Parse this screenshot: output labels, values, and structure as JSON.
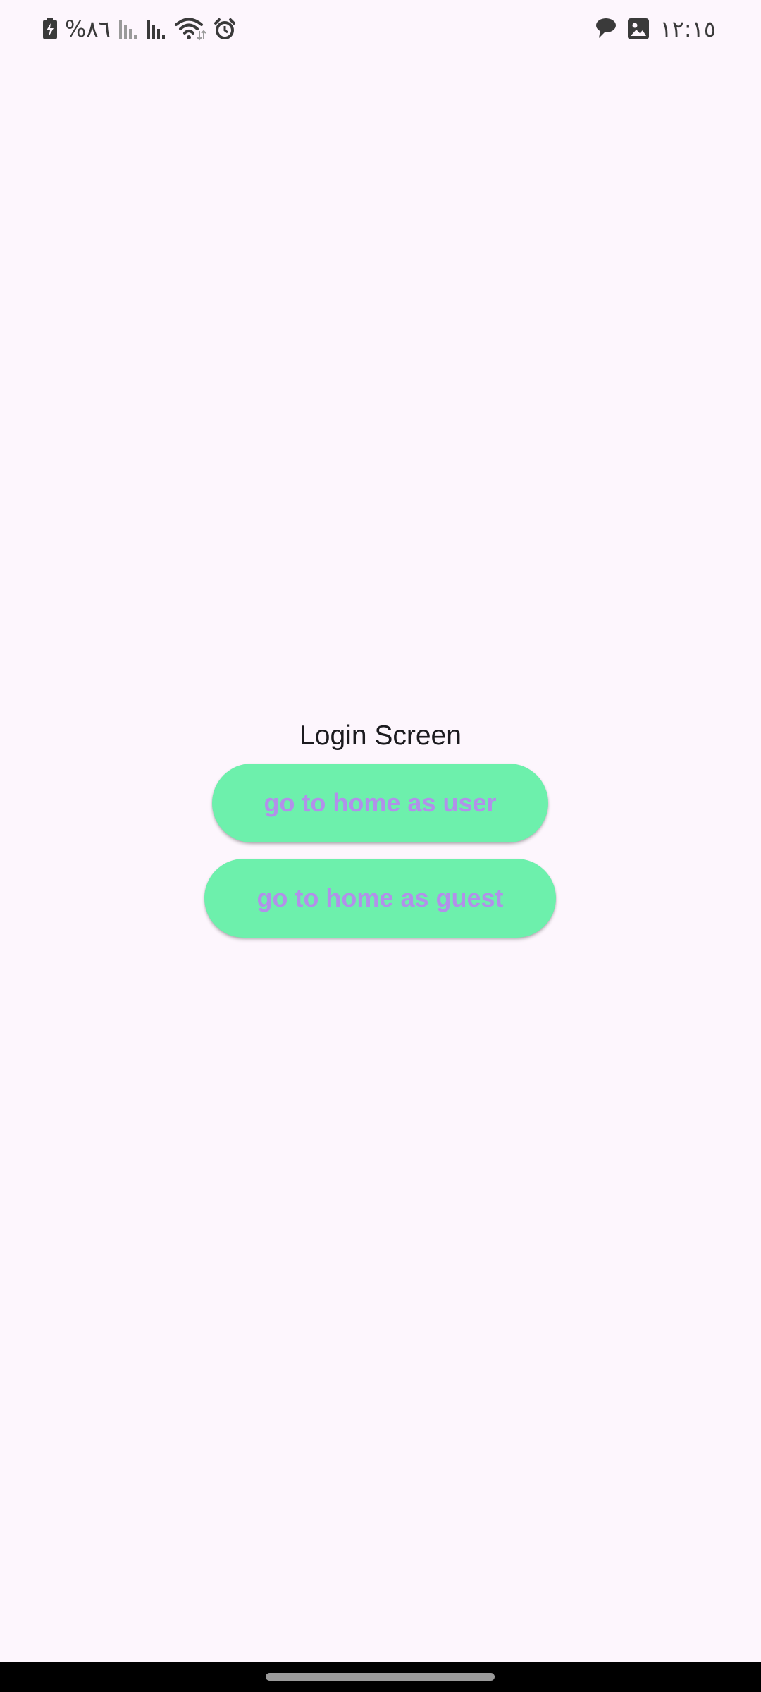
{
  "status_bar": {
    "battery_percent": "%٨٦",
    "time": "١٢:١٥",
    "icons_left": [
      "battery-charging-icon",
      "signal-icon",
      "signal-icon",
      "wifi-icon",
      "alarm-icon"
    ],
    "icons_right": [
      "chat-icon",
      "image-icon"
    ]
  },
  "main": {
    "title": "Login Screen",
    "button_user_label": "go to home as user",
    "button_guest_label": "go to home as guest"
  },
  "colors": {
    "background": "#fdf6fd",
    "button_background": "#6df0ac",
    "button_text": "#b290ea",
    "title_text": "#1c1b1f",
    "status_icon": "#3a3a3a",
    "nav_bar": "#000000"
  }
}
